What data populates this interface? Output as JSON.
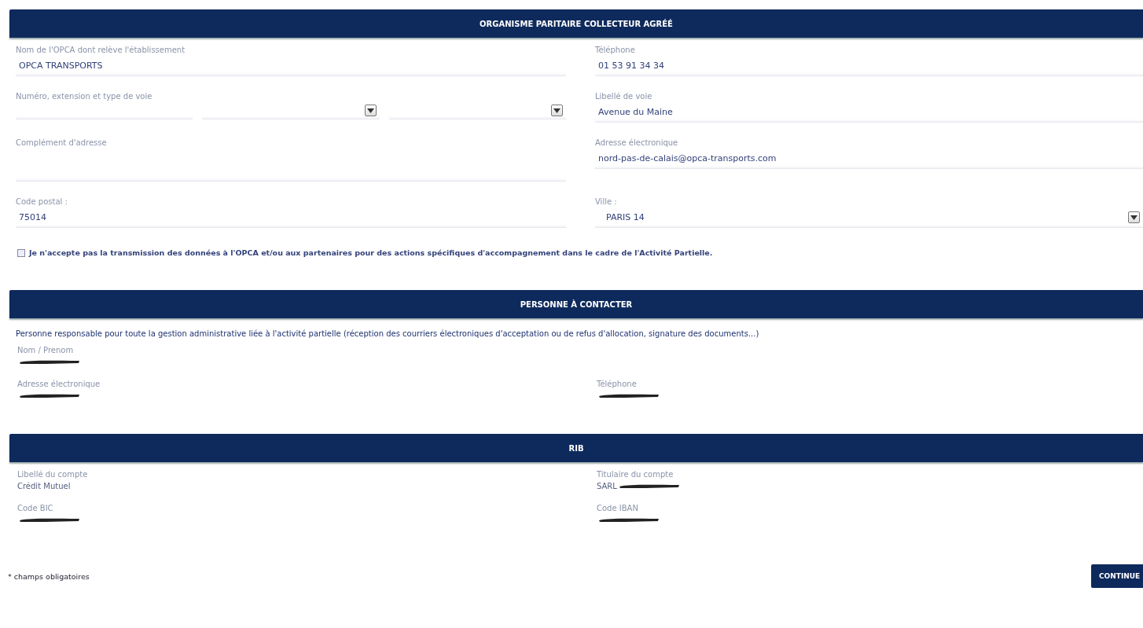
{
  "sections": [
    {
      "title": "ORGANISME PARITAIRE COLLECTEUR AGRÉÉ",
      "rows": [
        {
          "cells": [
            {
              "kind": "text",
              "label": "Nom de l'OPCA dont relève l'établissement",
              "value": "OPCA TRANSPORTS"
            },
            {
              "kind": "text",
              "label": "Téléphone",
              "value": "01 53 91 34 34"
            }
          ]
        },
        {
          "cells": [
            {
              "kind": "multi",
              "label": "Numéro, extension et type de voie",
              "parts": [
                {
                  "kind": "text"
                },
                {
                  "kind": "select"
                },
                {
                  "kind": "select"
                }
              ]
            },
            {
              "kind": "text",
              "label": "Libellé de voie",
              "value": "Avenue du Maine"
            }
          ]
        },
        {
          "cells": [
            {
              "kind": "textarea",
              "label": "Complément d'adresse"
            },
            {
              "kind": "text",
              "label": "Adresse électronique",
              "value": "nord-pas-de-calais@opca-transports.com"
            }
          ]
        },
        {
          "cells": [
            {
              "kind": "text",
              "label": "Code postal :",
              "value": "75014"
            },
            {
              "kind": "select",
              "label": "Ville :",
              "value": "PARIS 14"
            }
          ]
        }
      ],
      "consent": {
        "label": "Je n'accepte pas la transmission des données à l'OPCA et/ou aux partenaires pour des actions spécifiques d'accompagnement dans le cadre de l'Activité Partielle.",
        "checked": false
      }
    },
    {
      "title": "PERSONNE À CONTACTER",
      "description": "Personne responsable pour toute la gestion administrative liée à l'activité partielle (réception des courriers électroniques d'acceptation ou de refus d'allocation, signature des documents...)",
      "rows": [
        {
          "cells": [
            {
              "kind": "plain",
              "label": "Nom / Prenom",
              "redacted": true
            }
          ]
        },
        {
          "cells": [
            {
              "kind": "plain",
              "label": "Adresse électronique",
              "redacted": true
            },
            {
              "kind": "plain",
              "label": "Téléphone",
              "redacted": true
            }
          ]
        }
      ]
    },
    {
      "title": "RIB",
      "rows": [
        {
          "cells": [
            {
              "kind": "plain",
              "label": "Libellé du compte",
              "value": "Crédit Mutuel"
            },
            {
              "kind": "plain",
              "label": "Titulaire du compte",
              "value": "SARL",
              "redacted": true
            }
          ]
        },
        {
          "cells": [
            {
              "kind": "plain",
              "label": "Code BIC",
              "redacted": true
            },
            {
              "kind": "plain",
              "label": "Code IBAN",
              "redacted": true
            }
          ]
        }
      ]
    }
  ],
  "footer": {
    "note": "* champs obligatoires",
    "button": "CONTINUE"
  }
}
